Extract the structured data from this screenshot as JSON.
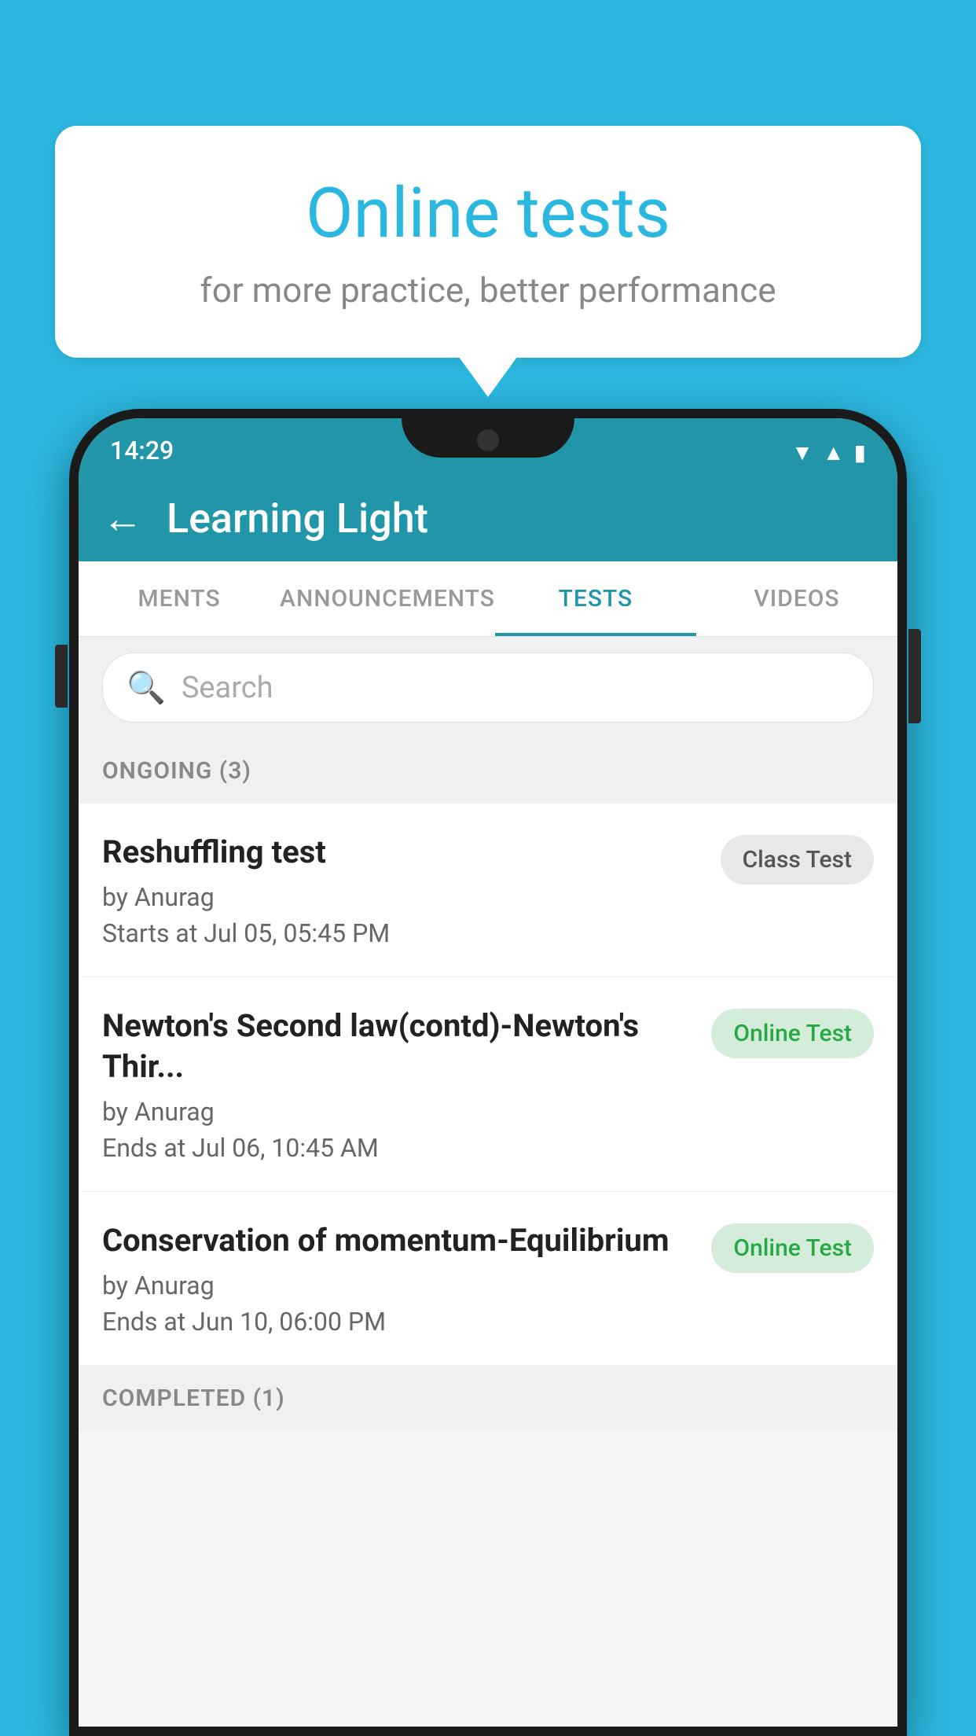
{
  "background": {
    "color": "#2BB8E0"
  },
  "speech_bubble": {
    "title": "Online tests",
    "subtitle": "for more practice, better performance"
  },
  "phone": {
    "status_bar": {
      "time": "14:29",
      "icons": [
        "wifi",
        "signal",
        "battery"
      ]
    },
    "app_bar": {
      "back_label": "←",
      "title": "Learning Light"
    },
    "tabs": [
      {
        "label": "MENTS",
        "active": false
      },
      {
        "label": "ANNOUNCEMENTS",
        "active": false
      },
      {
        "label": "TESTS",
        "active": true
      },
      {
        "label": "VIDEOS",
        "active": false
      }
    ],
    "search": {
      "placeholder": "Search"
    },
    "sections": [
      {
        "title": "ONGOING (3)",
        "tests": [
          {
            "name": "Reshuffling test",
            "by": "by Anurag",
            "date_label": "Starts at",
            "date": "Jul 05, 05:45 PM",
            "badge": "Class Test",
            "badge_type": "class"
          },
          {
            "name": "Newton's Second law(contd)-Newton's Thir...",
            "by": "by Anurag",
            "date_label": "Ends at",
            "date": "Jul 06, 10:45 AM",
            "badge": "Online Test",
            "badge_type": "online"
          },
          {
            "name": "Conservation of momentum-Equilibrium",
            "by": "by Anurag",
            "date_label": "Ends at",
            "date": "Jun 10, 06:00 PM",
            "badge": "Online Test",
            "badge_type": "online"
          }
        ]
      }
    ],
    "completed_section_title": "COMPLETED (1)"
  }
}
